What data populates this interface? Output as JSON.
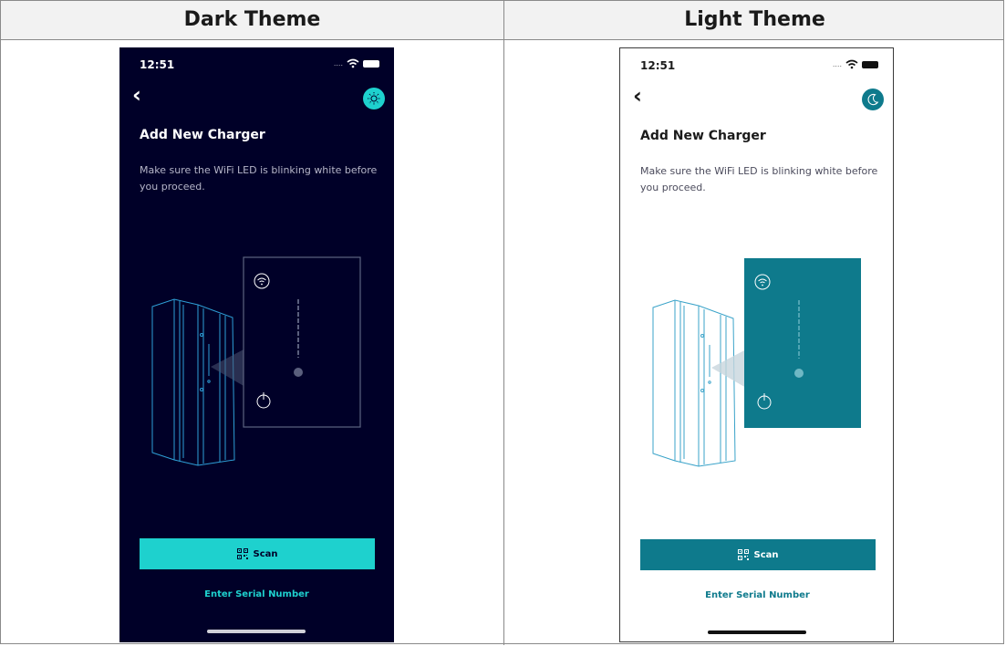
{
  "table": {
    "headers": [
      "Dark Theme",
      "Light Theme"
    ]
  },
  "screens": {
    "dark": {
      "status_time": "12:51",
      "title": "Add New Charger",
      "description": "Make sure the WiFi LED is blinking white before you proceed.",
      "scan_label": "Scan",
      "serial_link": "Enter Serial Number",
      "theme_toggle_icon": "sun-icon",
      "accent_color": "#1ed1ce",
      "background_color": "#000028"
    },
    "light": {
      "status_time": "12:51",
      "title": "Add New Charger",
      "description": "Make sure the WiFi LED is blinking white before you proceed.",
      "scan_label": "Scan",
      "serial_link": "Enter Serial Number",
      "theme_toggle_icon": "moon-icon",
      "accent_color": "#0e7a8c",
      "background_color": "#ffffff"
    }
  }
}
